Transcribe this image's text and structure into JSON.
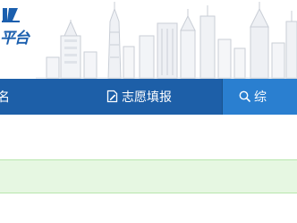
{
  "header": {
    "logo_text": "平台"
  },
  "nav": {
    "items": [
      {
        "label": "名"
      },
      {
        "label": "志愿填报",
        "icon": "edit-document-icon"
      },
      {
        "label": "综",
        "icon": "search-icon"
      }
    ]
  },
  "colors": {
    "nav_bg": "#1d5fa8",
    "nav_active_bg": "#2a7fd0",
    "notice_bg": "#e6f7e2",
    "notice_border": "#b7e6ad",
    "logo_color": "#1b5fae"
  }
}
